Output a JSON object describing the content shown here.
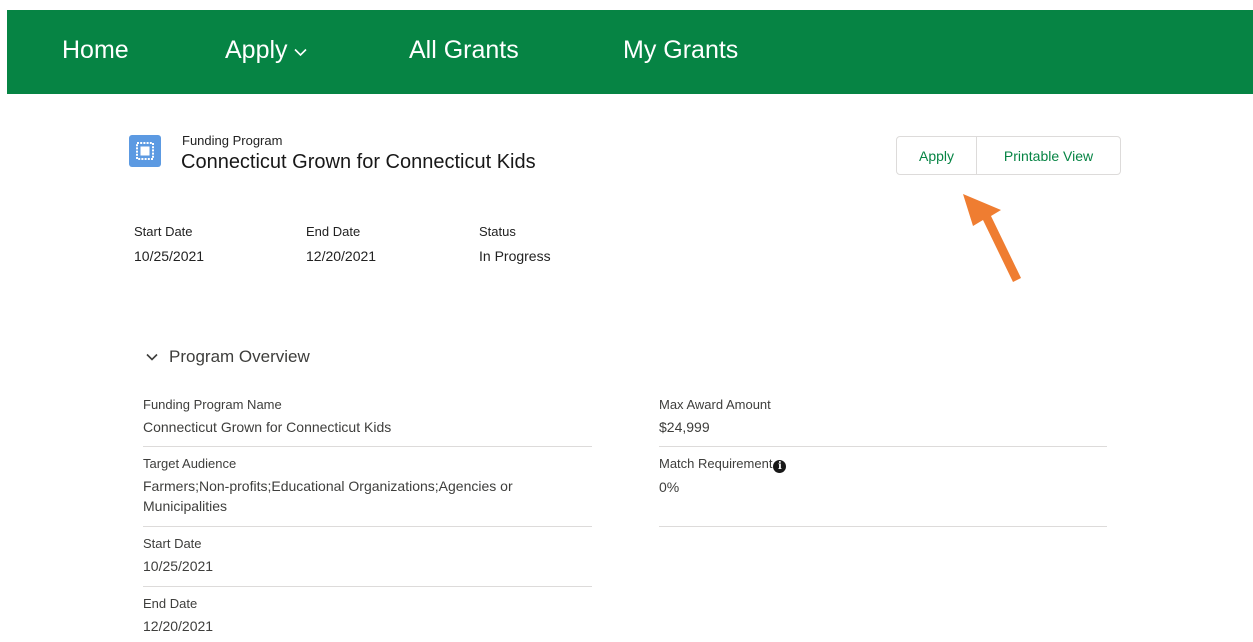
{
  "nav": {
    "home": "Home",
    "apply": "Apply",
    "all_grants": "All Grants",
    "my_grants": "My Grants"
  },
  "header": {
    "eyebrow": "Funding Program",
    "title": "Connecticut Grown for Connecticut Kids",
    "buttons": {
      "apply": "Apply",
      "printable": "Printable View"
    }
  },
  "highlights": {
    "start_date_label": "Start Date",
    "start_date_value": "10/25/2021",
    "end_date_label": "End Date",
    "end_date_value": "12/20/2021",
    "status_label": "Status",
    "status_value": "In Progress"
  },
  "section": {
    "title": "Program Overview",
    "left": [
      {
        "label": "Funding Program Name",
        "value": "Connecticut Grown for Connecticut Kids"
      },
      {
        "label": "Target Audience",
        "value": "Farmers;Non-profits;Educational Organizations;Agencies or Municipalities"
      },
      {
        "label": "Start Date",
        "value": "10/25/2021"
      },
      {
        "label": "End Date",
        "value": "12/20/2021"
      }
    ],
    "right": [
      {
        "label": "Max Award Amount",
        "value": "$24,999"
      },
      {
        "label": "Match Requirement",
        "value": "0%"
      }
    ]
  },
  "colors": {
    "brand_green": "#068444",
    "icon_blue": "#5c9ae2",
    "arrow_orange": "#ef7d31"
  }
}
